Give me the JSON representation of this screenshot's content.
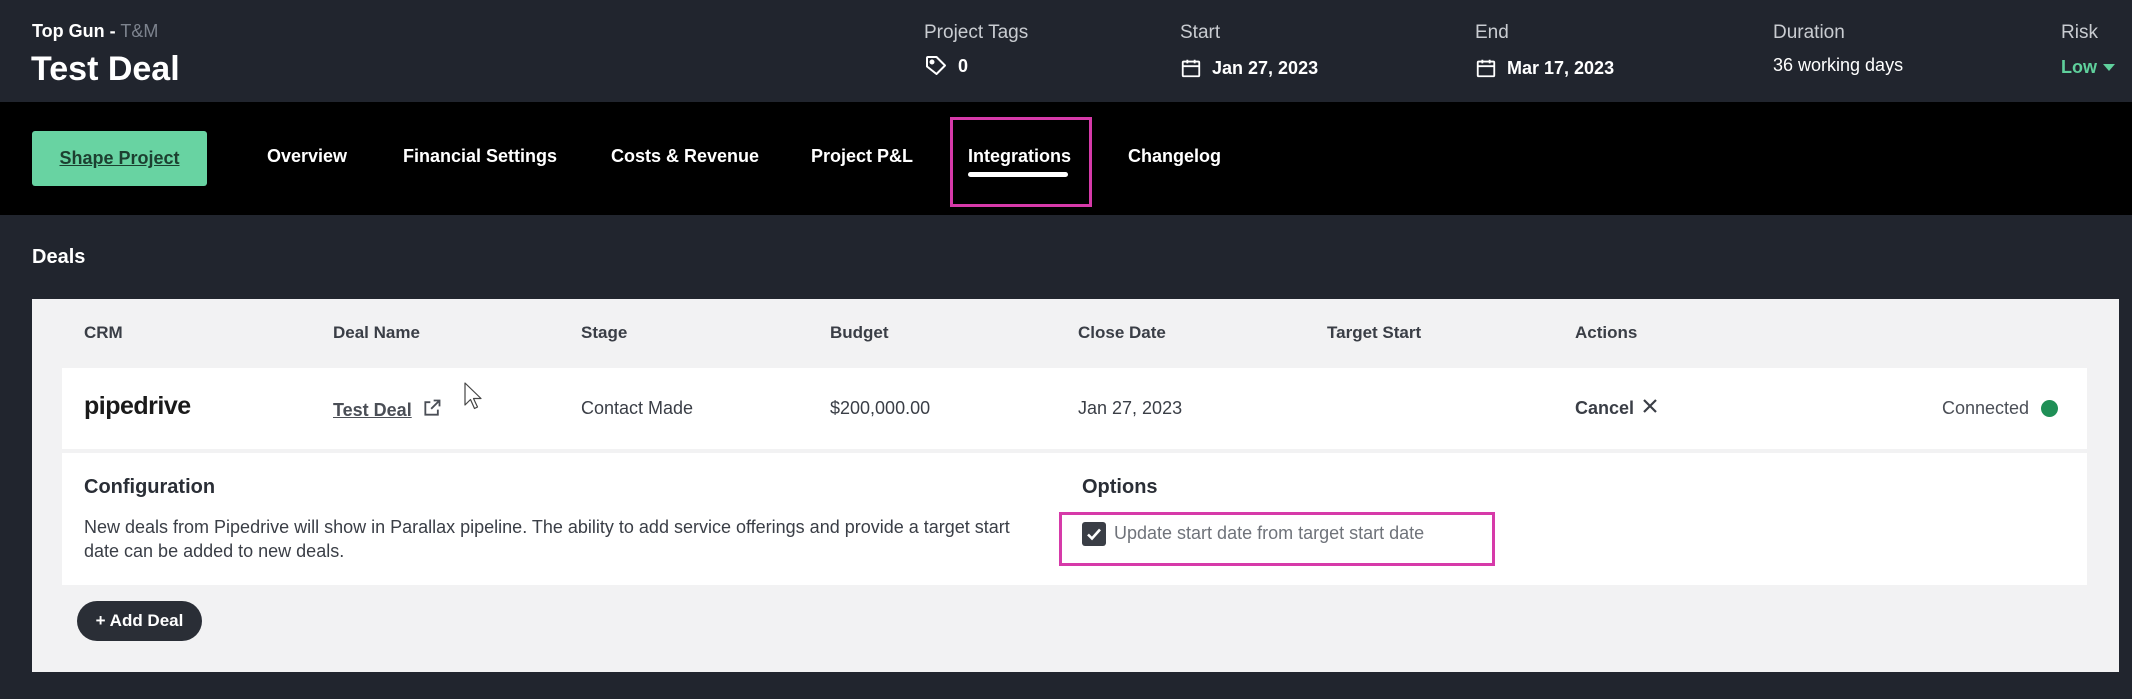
{
  "header": {
    "client": "Top Gun -",
    "project_type": "T&M",
    "title": "Test Deal",
    "project_tags": {
      "label": "Project Tags",
      "value": "0",
      "icon": "tag-icon"
    },
    "start": {
      "label": "Start",
      "value": "Jan 27, 2023",
      "icon": "calendar-icon"
    },
    "end": {
      "label": "End",
      "value": "Mar 17, 2023",
      "icon": "calendar-icon"
    },
    "duration": {
      "label": "Duration",
      "value": "36 working days"
    },
    "risk": {
      "label": "Risk",
      "value": "Low",
      "color": "#5fd09c"
    }
  },
  "nav": {
    "primary_button": "Shape Project",
    "tabs": [
      "Overview",
      "Financial Settings",
      "Costs & Revenue",
      "Project P&L",
      "Integrations",
      "Changelog"
    ],
    "active_tab": "Integrations"
  },
  "deals": {
    "section_title": "Deals",
    "columns": [
      "CRM",
      "Deal Name",
      "Stage",
      "Budget",
      "Close Date",
      "Target Start",
      "Actions"
    ],
    "rows": [
      {
        "crm": "pipedrive",
        "deal_name": "Test Deal",
        "stage": "Contact Made",
        "budget": "$200,000.00",
        "close_date": "Jan 27, 2023",
        "target_start": "",
        "action": "Cancel",
        "status": "Connected",
        "status_color": "#1f8f56"
      }
    ],
    "configuration": {
      "title": "Configuration",
      "description": "New deals from Pipedrive will show in Parallax pipeline. The ability to add service offerings and provide a target start date can be added to new deals."
    },
    "options": {
      "title": "Options",
      "update_start_date": {
        "label": "Update start date from target start date",
        "checked": true
      }
    },
    "add_button": "+ Add Deal"
  },
  "colors": {
    "background": "#21252e",
    "nav_background": "#000000",
    "accent_green": "#68d3a2",
    "highlight": "#d63aa9"
  }
}
